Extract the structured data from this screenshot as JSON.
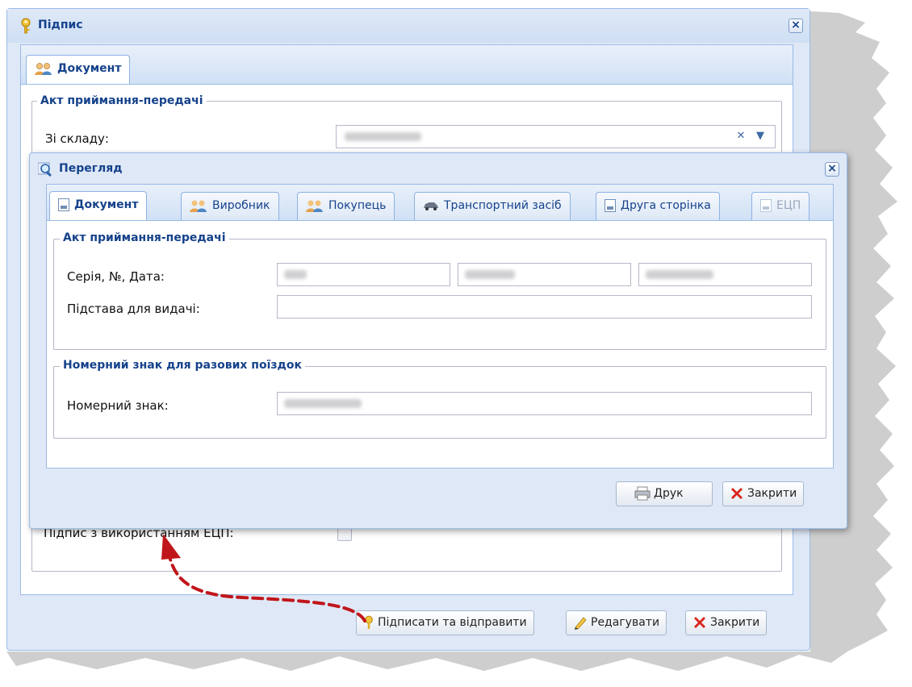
{
  "outer_window": {
    "title": "Підпис",
    "tab_document": "Документ",
    "fieldset_title": "Акт приймання-передачі",
    "from_warehouse_label": "Зі складу:",
    "signature_label": "Підпис з використанням ЕЦП:",
    "buttons": {
      "sign_send": "Підписати та відправити",
      "edit": "Редагувати",
      "close": "Закрити"
    }
  },
  "preview_window": {
    "title": "Перегляд",
    "tabs": [
      "Документ",
      "Виробник",
      "Покупець",
      "Транспортний засіб",
      "Друга сторінка",
      "ЕЦП"
    ],
    "fieldset_act": "Акт приймання-передачі",
    "series_label": "Серія, №, Дата:",
    "basis_label": "Підстава для видачі:",
    "fieldset_plate": "Номерний знак для разових поїздок",
    "plate_label": "Номерний знак:",
    "buttons": {
      "print": "Друк",
      "close": "Закрити"
    }
  },
  "colors": {
    "accent": "#15428b",
    "panel": "#dfe8f6",
    "border": "#99bbe8",
    "arrow": "#c0161b"
  }
}
